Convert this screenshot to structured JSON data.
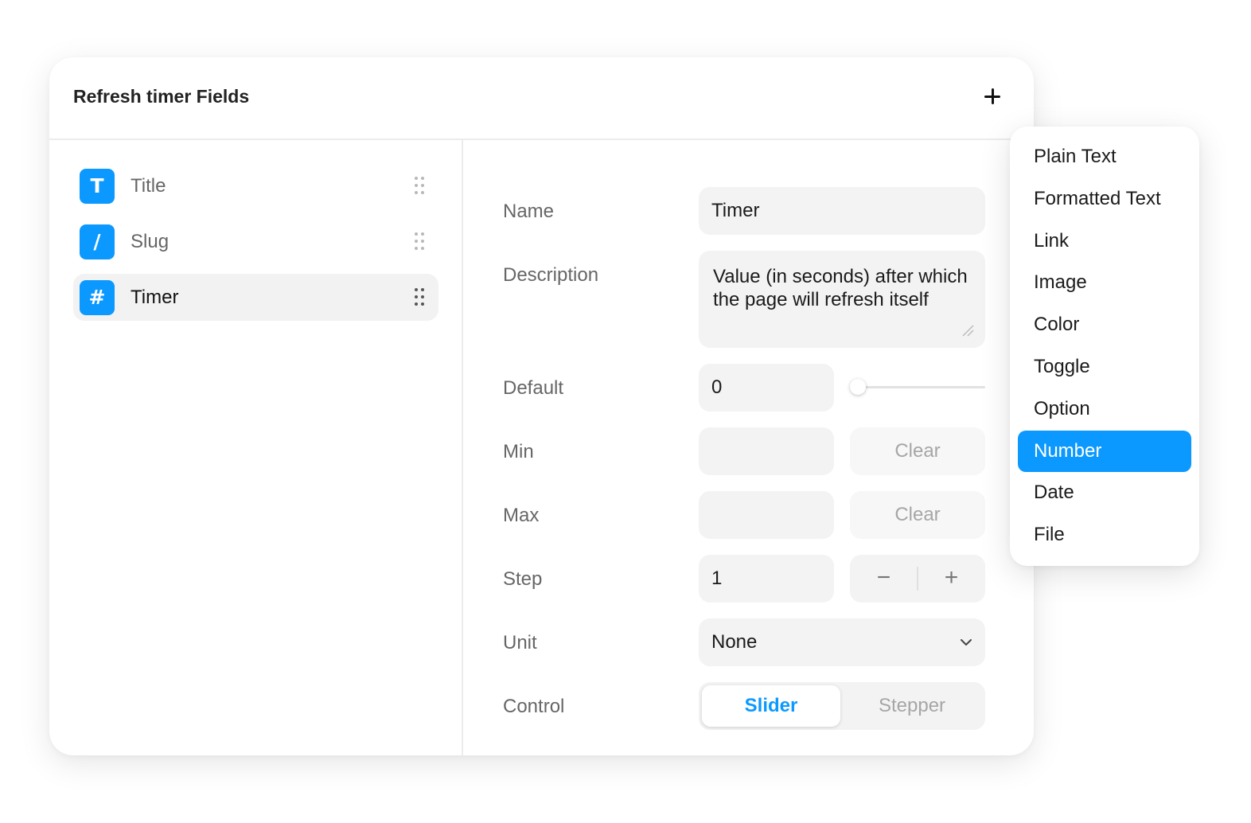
{
  "panel": {
    "title": "Refresh timer Fields"
  },
  "fields": [
    {
      "label": "Title",
      "icon": "T",
      "icon_name": "text-type-icon"
    },
    {
      "label": "Slug",
      "icon": "/",
      "icon_name": "slug-type-icon"
    },
    {
      "label": "Timer",
      "icon": "#",
      "icon_name": "number-type-icon",
      "selected": true
    }
  ],
  "form": {
    "name_label": "Name",
    "name_value": "Timer",
    "description_label": "Description",
    "description_value": "Value (in seconds) after which the page will refresh itself",
    "default_label": "Default",
    "default_value": "0",
    "slider_value": 0,
    "min_label": "Min",
    "min_value": "",
    "min_clear": "Clear",
    "max_label": "Max",
    "max_value": "",
    "max_clear": "Clear",
    "step_label": "Step",
    "step_value": "1",
    "step_minus": "−",
    "step_plus": "+",
    "unit_label": "Unit",
    "unit_value": "None",
    "control_label": "Control",
    "control_options": [
      "Slider",
      "Stepper"
    ],
    "control_selected": "Slider"
  },
  "menu": {
    "items": [
      "Plain Text",
      "Formatted Text",
      "Link",
      "Image",
      "Color",
      "Toggle",
      "Option",
      "Number",
      "Date",
      "File"
    ],
    "active": "Number"
  },
  "colors": {
    "accent": "#0b99ff"
  }
}
